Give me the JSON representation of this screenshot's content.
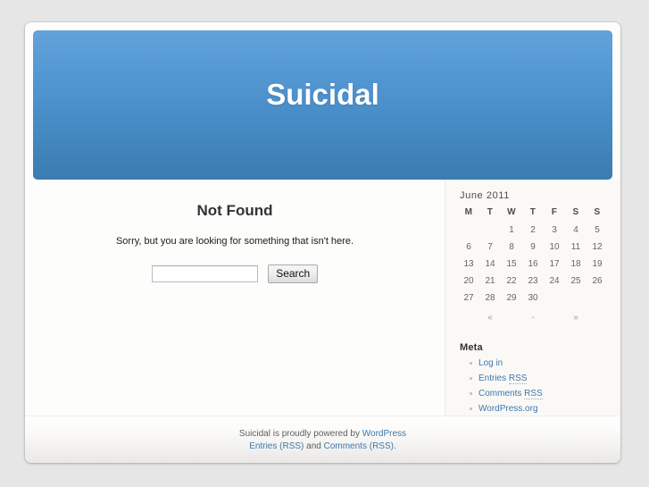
{
  "site": {
    "title": "Suicidal"
  },
  "content": {
    "heading": "Not Found",
    "message": "Sorry, but you are looking for something that isn't here.",
    "search": {
      "value": "",
      "placeholder": "",
      "submit_label": "Search"
    }
  },
  "sidebar": {
    "calendar": {
      "caption": "June 2011",
      "weekdays": [
        "M",
        "T",
        "W",
        "T",
        "F",
        "S",
        "S"
      ],
      "weeks": [
        [
          "",
          "",
          "1",
          "2",
          "3",
          "4",
          "5"
        ],
        [
          "6",
          "7",
          "8",
          "9",
          "10",
          "11",
          "12"
        ],
        [
          "13",
          "14",
          "15",
          "16",
          "17",
          "18",
          "19"
        ],
        [
          "20",
          "21",
          "22",
          "23",
          "24",
          "25",
          "26"
        ],
        [
          "27",
          "28",
          "29",
          "30",
          "",
          "",
          ""
        ]
      ],
      "nav_prev": "«",
      "nav_separator": "-",
      "nav_next": "»"
    },
    "meta": {
      "title": "Meta",
      "items": [
        {
          "label": "Log in",
          "abbr": ""
        },
        {
          "label": "Entries ",
          "abbr": "RSS"
        },
        {
          "label": "Comments ",
          "abbr": "RSS"
        },
        {
          "label": "WordPress.org",
          "abbr": ""
        }
      ]
    }
  },
  "footer": {
    "line1_prefix": "Suicidal is proudly powered by ",
    "line1_link": "WordPress",
    "line2_link1": "Entries (RSS)",
    "line2_middle": " and ",
    "line2_link2": "Comments (RSS)",
    "line2_suffix": "."
  },
  "colors": {
    "page_background": "#e6e6e6",
    "header_gradient_top": "#63a2da",
    "header_gradient_bottom": "#3b7cb0",
    "link": "#3f77ab",
    "sidebar_background": "#faf9f6"
  }
}
